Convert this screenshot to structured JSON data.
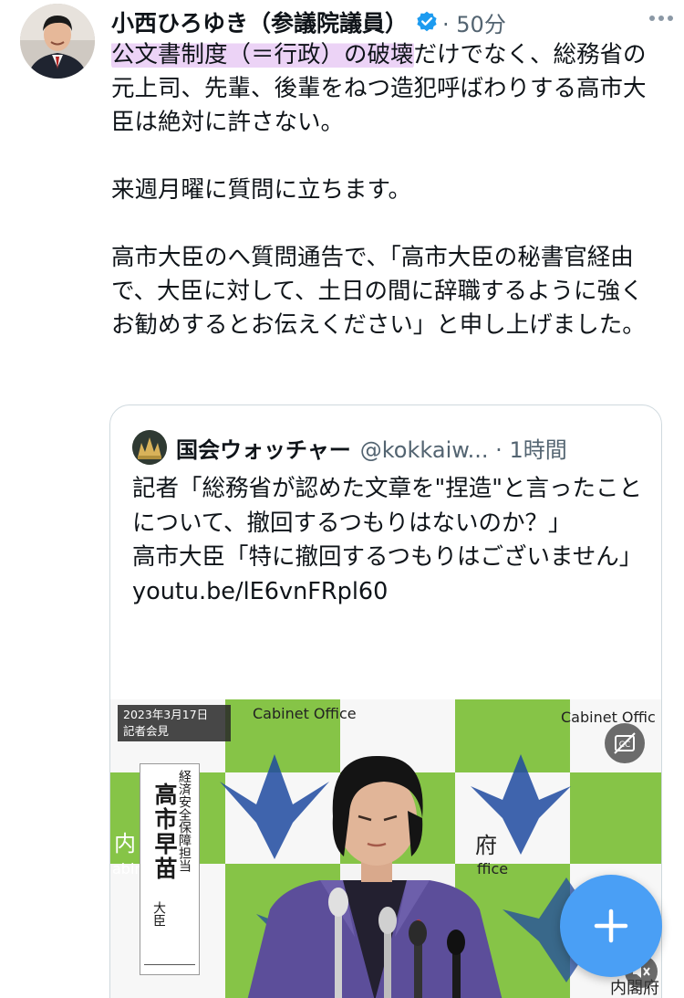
{
  "author": {
    "name": "小西ひろゆき（参議院議員）",
    "verified": true,
    "time": "· 50分",
    "avatar": "avatar-photo"
  },
  "more_icon": "more-horizontal-icon",
  "tweet": {
    "highlight": "公文書制度（＝行政）の破壊",
    "line1_rest": "だけでなく、総務省の元上司、先輩、後輩をねつ造犯呼ばわりする高市大臣は絶対に許さない。",
    "para2": "来週月曜に質問に立ちます。",
    "para3": "高市大臣のへ質問通告で、「高市大臣の秘書官経由で、大臣に対して、土日の間に辞職するように強くお勧めするとお伝えください」と申し上げました。"
  },
  "quote": {
    "name": "国会ウォッチャー",
    "handle": "@kokkaiw... · 1時間",
    "line1": "記者「総務省が認めた文章を\"捏造\"と言ったことについて、撤回するつもりはないのか？」",
    "line2": "高市大臣「特に撤回するつもりはございません」",
    "link": "youtu.be/lE6vnFRpl60",
    "video": {
      "date_tag": "2023年3月17日",
      "event_tag": "記者会見",
      "name_role": "経済安全保障担当",
      "name_person": "高市早苗",
      "name_title": "大臣",
      "cabinet_label_left": "Cabinet Office",
      "cabinet_label_right": "Cabinet Offic",
      "side_left": "内",
      "side_left2": "abin",
      "side_right": "府",
      "side_right2": "ffice",
      "bottom_right": "内閣府"
    }
  },
  "colors": {
    "highlight": "#ecd3f6",
    "verified": "#1d9bf0",
    "fab": "#4a9ff5",
    "board_green": "#7fbf3f",
    "jacket": "#5c4e9a"
  }
}
